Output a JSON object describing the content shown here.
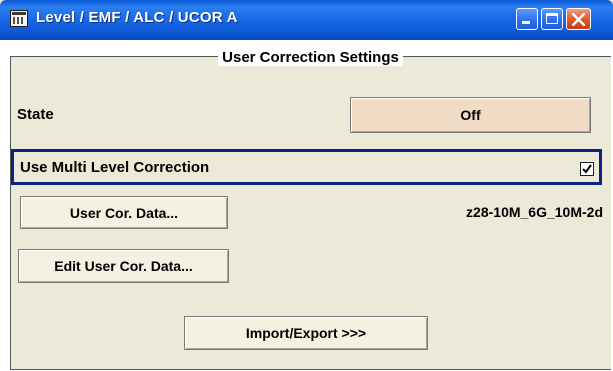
{
  "window": {
    "title": "Level / EMF / ALC / UCOR  A"
  },
  "group": {
    "title": "User Correction Settings"
  },
  "state": {
    "label": "State",
    "value": "Off"
  },
  "multi_level": {
    "label": "Use Multi Level Correction",
    "checked": true
  },
  "user_cor_data": {
    "button_label": "User Cor. Data...",
    "file_name": "z28-10M_6G_10M-2d"
  },
  "edit_user_cor_data": {
    "button_label": "Edit User Cor. Data..."
  },
  "import_export": {
    "button_label": "Import/Export >>>"
  },
  "colors": {
    "titlebar": "#1868e6",
    "state_button": "#f0dcc5",
    "focus_border": "#0b257e",
    "panel": "#ece9d8"
  },
  "icons": [
    "app-menu-icon",
    "minimize-icon",
    "maximize-icon",
    "close-icon",
    "checkmark-icon"
  ]
}
